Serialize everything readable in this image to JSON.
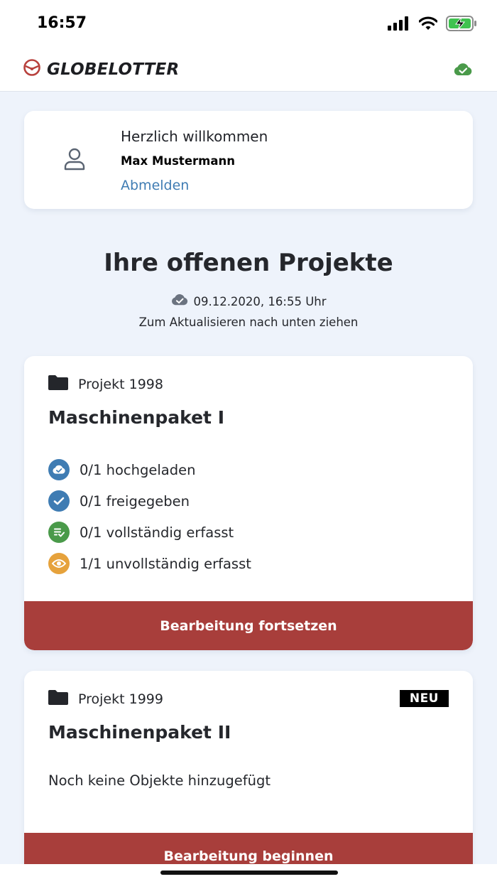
{
  "status_bar": {
    "time": "16:57",
    "icons": [
      "cellular-signal-icon",
      "wifi-icon",
      "battery-charging-icon"
    ]
  },
  "header": {
    "brand": "GLOBELOTTER",
    "logo_icon": "globelotter-logo-icon",
    "sync_icon": "cloud-check-icon",
    "sync_color": "#4a9a4a"
  },
  "welcome": {
    "greeting": "Herzlich willkommen",
    "user_name": "Max Mustermann",
    "logout_label": "Abmelden",
    "avatar_icon": "user-icon"
  },
  "main": {
    "title": "Ihre offenen Projekte",
    "last_sync": "09.12.2020, 16:55 Uhr",
    "refresh_hint": "Zum Aktualisieren nach unten ziehen"
  },
  "projects": [
    {
      "number": "Projekt 1998",
      "name": "Maschinenpaket I",
      "stats": [
        {
          "label": "0/1 hochgeladen",
          "icon": "cloud-upload-icon",
          "color": "#3f7cb3"
        },
        {
          "label": "0/1 freigegeben",
          "icon": "check-icon",
          "color": "#3f7cb3"
        },
        {
          "label": "0/1 vollständig erfasst",
          "icon": "list-check-icon",
          "color": "#4a9a4a"
        },
        {
          "label": "1/1 unvollständig erfasst",
          "icon": "eye-icon",
          "color": "#e6a23c"
        }
      ],
      "button_label": "Bearbeitung fortsetzen"
    },
    {
      "number": "Projekt 1999",
      "badge": "NEU",
      "name": "Maschinenpaket II",
      "empty_text": "Noch keine Objekte hinzugefügt",
      "button_label": "Bearbeitung beginnen"
    }
  ],
  "colors": {
    "background": "#eef3fb",
    "accent_red": "#a83e3b",
    "link_blue": "#3f7cb3"
  }
}
